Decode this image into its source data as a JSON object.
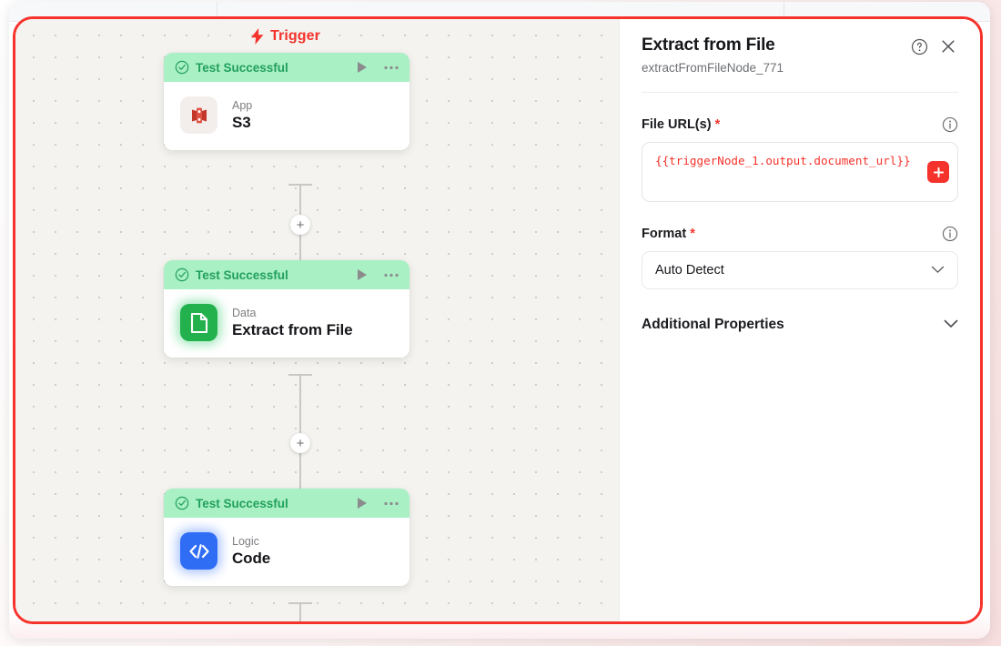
{
  "canvas": {
    "trigger_label": "Trigger",
    "trigger_icon": "lightning-bolt-icon",
    "nodes": [
      {
        "status": "Test Successful",
        "status_icon": "check-circle-icon",
        "run_icon": "play-icon",
        "menu_icon": "ellipsis-icon",
        "category": "App",
        "title": "S3",
        "icon": "s3-bucket-icon",
        "icon_color": "#c4352a"
      },
      {
        "status": "Test Successful",
        "status_icon": "check-circle-icon",
        "run_icon": "play-icon",
        "menu_icon": "ellipsis-icon",
        "category": "Data",
        "title": "Extract from File",
        "icon": "document-icon",
        "icon_color": "#22b14c"
      },
      {
        "status": "Test Successful",
        "status_icon": "check-circle-icon",
        "run_icon": "play-icon",
        "menu_icon": "ellipsis-icon",
        "category": "Logic",
        "title": "Code",
        "icon": "code-brackets-icon",
        "icon_color": "#2f6df5"
      }
    ],
    "add_node_label": "+"
  },
  "panel": {
    "title": "Extract from File",
    "subtitle": "extractFromFileNode_771",
    "help_icon": "question-circle-icon",
    "close_icon": "close-icon",
    "fields": [
      {
        "label": "File URL(s)",
        "required_marker": "*",
        "info_icon": "info-icon",
        "value": "{{triggerNode_1.output.document_url}}",
        "add_button_label": "+",
        "add_button_color": "#f5332c"
      },
      {
        "label": "Format",
        "required_marker": "*",
        "info_icon": "info-icon",
        "value": "Auto Detect",
        "chevron_icon": "chevron-down-icon"
      }
    ],
    "additional_properties": {
      "label": "Additional Properties",
      "chevron_icon": "chevron-down-icon"
    }
  },
  "theme": {
    "accent_red": "#f5332c",
    "status_green_bg": "#a9f0c4",
    "status_green_text": "#22a05c",
    "canvas_bg": "#f4f3ef"
  }
}
